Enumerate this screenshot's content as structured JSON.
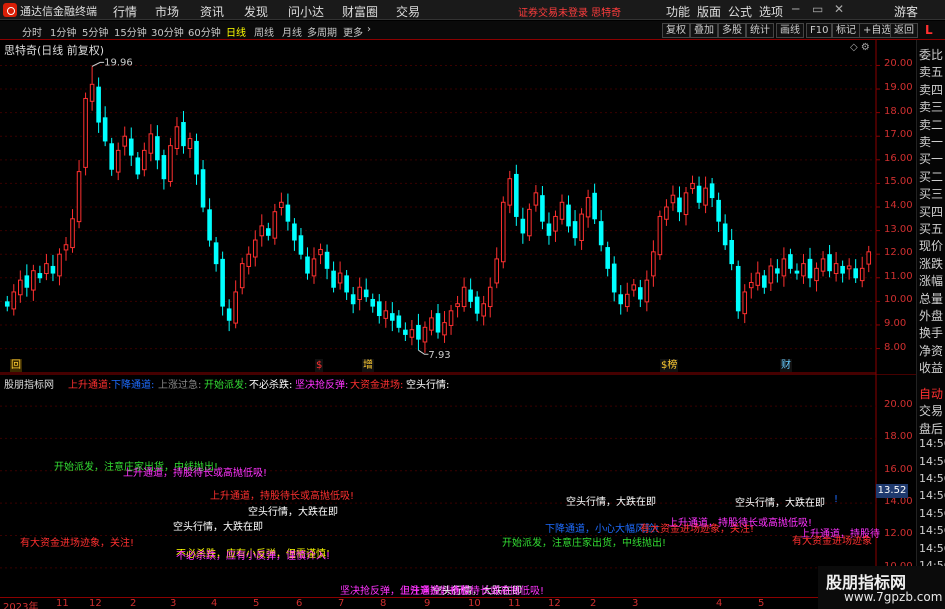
{
  "titlebar": {
    "app_name": "通达信金融终端",
    "menus": [
      "行情",
      "市场",
      "资讯",
      "发现",
      "问小达",
      "财富圈",
      "交易"
    ],
    "notice": "证券交易未登录 思特奇",
    "right_menus": [
      "功能",
      "版面",
      "公式",
      "选项"
    ],
    "guest": "游客",
    "logo_icon": "tdx-logo-icon"
  },
  "toolbar": {
    "periods": [
      "分时",
      "1分钟",
      "5分钟",
      "15分钟",
      "30分钟",
      "60分钟",
      "日线",
      "周线",
      "月线",
      "多周期",
      "更多"
    ],
    "active_period": "日线",
    "more_arrow": "›",
    "buttons": [
      "复权",
      "叠加",
      "多股",
      "统计",
      "画线",
      "F10",
      "标记",
      "+自选",
      "返回"
    ],
    "l_label": "L"
  },
  "chart": {
    "title": "思特奇(日线 前复权)",
    "high_marker": "19.96",
    "low_marker": "7.93",
    "price_axis": [
      "20.00",
      "19.00",
      "18.00",
      "17.00",
      "16.00",
      "15.00",
      "14.00",
      "13.00",
      "12.00",
      "11.00",
      "10.00",
      "9.00",
      "8.00"
    ],
    "up_color": "#ff3030",
    "down_color": "#00ffff",
    "events": [
      {
        "label": "回",
        "color": "#ffcc33"
      },
      {
        "label": "$",
        "color": "#ff3030"
      },
      {
        "label": "增",
        "color": "#ffcc33"
      },
      {
        "label": "$榜",
        "color": "#ffcc33"
      },
      {
        "label": "财",
        "color": "#66ccff"
      }
    ]
  },
  "chart_data": {
    "type": "candlestick",
    "title": "思特奇(日线 前复权)",
    "ylim": [
      7.6,
      20.4
    ],
    "high": 19.96,
    "low": 7.93,
    "last": 12.1,
    "close_path": [
      9.8,
      10.4,
      10.9,
      10.6,
      11.3,
      11.0,
      11.6,
      11.2,
      12.0,
      12.4,
      13.5,
      15.5,
      18.6,
      19.2,
      17.6,
      16.8,
      15.6,
      16.4,
      17.0,
      16.2,
      15.4,
      16.4,
      17.1,
      16.0,
      15.2,
      16.6,
      17.4,
      16.6,
      16.9,
      15.4,
      14.0,
      12.6,
      11.6,
      9.8,
      9.2,
      10.4,
      11.6,
      12.0,
      12.6,
      13.2,
      12.8,
      13.8,
      14.2,
      13.4,
      12.6,
      12.0,
      11.2,
      11.8,
      12.2,
      11.4,
      10.6,
      11.2,
      10.4,
      9.9,
      10.6,
      10.2,
      9.8,
      9.4,
      9.6,
      9.2,
      8.9,
      8.6,
      8.8,
      8.4,
      8.9,
      9.3,
      8.7,
      9.1,
      9.6,
      9.9,
      10.6,
      10.0,
      9.5,
      9.9,
      10.6,
      11.8,
      14.2,
      15.2,
      13.6,
      12.9,
      13.9,
      14.6,
      13.4,
      12.8,
      13.6,
      14.2,
      13.2,
      12.7,
      13.7,
      14.4,
      13.5,
      12.4,
      11.4,
      10.4,
      9.9,
      10.3,
      10.7,
      10.1,
      10.9,
      12.1,
      13.6,
      14.0,
      14.5,
      13.8,
      14.6,
      15.0,
      14.2,
      14.8,
      14.4,
      13.4,
      12.4,
      11.6,
      9.6,
      10.4,
      10.8,
      11.2,
      10.6,
      11.5,
      11.2,
      11.8,
      11.4,
      11.2,
      11.6,
      11.0,
      11.4,
      11.8,
      11.3,
      11.6,
      11.2,
      11.5,
      11.0,
      11.4,
      12.1
    ]
  },
  "indicator": {
    "name": "股朋指标网",
    "legend": [
      {
        "text": "上升通道:",
        "color": "#ff3030"
      },
      {
        "text": "下降通道:",
        "color": "#1e6cff"
      },
      {
        "text": "上涨过急:",
        "color": "#888888"
      },
      {
        "text": "开始派发:",
        "color": "#33dd33"
      },
      {
        "text": "不必杀跌:",
        "color": "#ffffff"
      },
      {
        "text": "坚决抢反弹:",
        "color": "#ff33ff"
      },
      {
        "text": "大资金进场:",
        "color": "#ff3030"
      },
      {
        "text": "空头行情:",
        "color": "#ffffff"
      }
    ],
    "axis": [
      "20.00",
      "18.00",
      "16.00",
      "14.00",
      "12.00",
      "10.00"
    ],
    "current_value": "13.52",
    "signals": [
      {
        "text": "开始派发，注意庄家出货，中线抛出!",
        "color": "#33dd33"
      },
      {
        "text": "上升通道，持股待长或高抛低吸!",
        "color": "#ff33ff"
      },
      {
        "text": "上升通道，持股待长或高抛低吸!",
        "color": "#ff3030"
      },
      {
        "text": "空头行情，大跌在即",
        "color": "#ffffff"
      },
      {
        "text": "空头行情，大跌在即",
        "color": "#ffffff"
      },
      {
        "text": "有大资金进场迹象，关注!",
        "color": "#ff3030"
      },
      {
        "text": "不必杀跌，应有小反弹，但需谨慎!",
        "color": "#ffff00"
      },
      {
        "text": "不必杀跌，应有小反弹，谨慎介入!",
        "color": "#ff33ff"
      },
      {
        "text": "坚决抢反弹，但注意控制仓位!",
        "color": "#ff33ff"
      },
      {
        "text": "空头行情，大跌在即",
        "color": "#ffffff"
      },
      {
        "text": "上升通道，持股待长或高抛低吸!",
        "color": "#ff33ff"
      },
      {
        "text": "空头行情，大跌在即",
        "color": "#ffffff"
      },
      {
        "text": "下降通道，小心大幅风险!",
        "color": "#1e6cff"
      },
      {
        "text": "开始派发，注意庄家出货，中线抛出!",
        "color": "#33dd33"
      },
      {
        "text": "有大资金进场迹象，关注!",
        "color": "#ff3030"
      },
      {
        "text": "上升通道，持股待长或高抛低吸!",
        "color": "#ff33ff"
      },
      {
        "text": "空头行情，大跌在即",
        "color": "#ffffff"
      },
      {
        "text": "上升通道，持股待",
        "color": "#ff33ff"
      },
      {
        "text": "有大资金进场迹象",
        "color": "#ff3030"
      },
      {
        "text": "!",
        "color": "#1e6cff"
      }
    ]
  },
  "right_tabs": {
    "upper": [
      "委比",
      "卖五",
      "卖四",
      "卖三",
      "卖二",
      "卖一",
      "买一",
      "买二",
      "买三",
      "买四",
      "买五",
      "现价",
      "涨跌",
      "涨幅",
      "总量",
      "外盘",
      "换手",
      "净资",
      "收益"
    ],
    "lower": [
      "自动",
      "交易",
      "盘后",
      "14:56",
      "14:56",
      "14:56",
      "14:56",
      "14:56",
      "14:56",
      "14:56",
      "14:56"
    ]
  },
  "date_axis": [
    "2023年",
    "11",
    "12",
    "2",
    "3",
    "4",
    "5",
    "6",
    "7",
    "8",
    "9",
    "10",
    "11",
    "12",
    "2",
    "3",
    "4",
    "5"
  ],
  "watermark": {
    "title": "股朋指标网",
    "url": "www.7gpzb.com"
  }
}
